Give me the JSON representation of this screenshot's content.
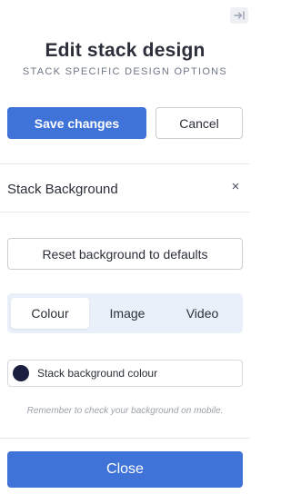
{
  "header": {
    "collapse_icon": "collapse-right-icon",
    "title": "Edit stack design",
    "subtitle": "STACK SPECIFIC DESIGN OPTIONS"
  },
  "actions": {
    "save_label": "Save changes",
    "cancel_label": "Cancel"
  },
  "section": {
    "title": "Stack Background",
    "close_icon": "×"
  },
  "background": {
    "reset_label": "Reset background to defaults",
    "tabs": [
      {
        "label": "Colour",
        "active": true
      },
      {
        "label": "Image",
        "active": false
      },
      {
        "label": "Video",
        "active": false
      }
    ],
    "colour_field_label": "Stack background colour",
    "colour_value": "#1b1f3f",
    "hint": "Remember to check your background on mobile."
  },
  "footer": {
    "close_label": "Close"
  },
  "colors": {
    "primary": "#3f73d8",
    "tab_bg": "#eaf0fa"
  }
}
